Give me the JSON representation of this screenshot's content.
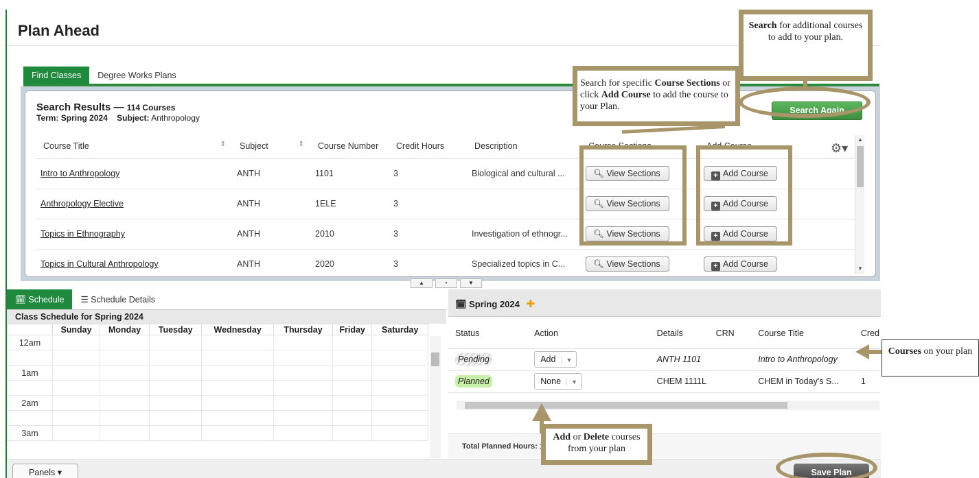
{
  "page_title": "Plan Ahead",
  "top_tabs": [
    "Find Classes",
    "Degree Works Plans"
  ],
  "results": {
    "heading": "Search Results —",
    "count": "114 Courses",
    "term_label": "Term:",
    "term": "Spring 2024",
    "subject_label": "Subject:",
    "subject": "Anthropology",
    "search_again": "Search Again",
    "columns": [
      "Course Title",
      "Subject",
      "Course Number",
      "Credit Hours",
      "Description",
      "Course Sections",
      "Add Course"
    ],
    "rows": [
      {
        "title": "Intro to Anthropology",
        "subject": "ANTH",
        "number": "1101",
        "credits": "3",
        "description": "Biological and cultural ...",
        "sections": "View Sections",
        "add": "Add Course"
      },
      {
        "title": "Anthropology Elective",
        "subject": "ANTH",
        "number": "1ELE",
        "credits": "3",
        "description": "",
        "sections": "View Sections",
        "add": "Add Course"
      },
      {
        "title": "Topics in Ethnography",
        "subject": "ANTH",
        "number": "2010",
        "credits": "3",
        "description": "Investigation of ethnogr...",
        "sections": "View Sections",
        "add": "Add Course"
      },
      {
        "title": "Topics in Cultural Anthropology",
        "subject": "ANTH",
        "number": "2020",
        "credits": "3",
        "description": "Specialized topics in C...",
        "sections": "View Sections",
        "add": "Add Course"
      }
    ]
  },
  "schedule": {
    "tabs": [
      "Schedule",
      "Schedule Details"
    ],
    "title": "Class Schedule for Spring 2024",
    "days": [
      "Sunday",
      "Monday",
      "Tuesday",
      "Wednesday",
      "Thursday",
      "Friday",
      "Saturday"
    ],
    "times": [
      "12am",
      "",
      "1am",
      "",
      "2am",
      "",
      "3am"
    ]
  },
  "plan": {
    "term": "Spring 2024",
    "columns": [
      "Status",
      "Action",
      "Details",
      "CRN",
      "Course Title",
      "Cred"
    ],
    "rows": [
      {
        "status": "Pending",
        "action": "Add",
        "details": "ANTH 1101",
        "crn": "",
        "title": "Intro to Anthropology",
        "credits": ""
      },
      {
        "status": "Planned",
        "action": "None",
        "details": "CHEM 1111L",
        "crn": "",
        "title": "CHEM in Today's S...",
        "credits": "1"
      }
    ],
    "total_label": "Total Planned Hours: 1"
  },
  "footer": {
    "panels": "Panels",
    "save_plan": "Save Plan"
  },
  "callouts": {
    "search_bold": "Search",
    "search_rest": " for additional courses to add to your plan.",
    "sections_pre": "Search for specific ",
    "sections_bold1": "Course Sections",
    "sections_mid": " or click ",
    "sections_bold2": "Add Course",
    "sections_post": " to add the course to your Plan.",
    "courses_bold": "Courses",
    "courses_rest": " on your plan",
    "add_bold": "Add",
    "add_mid": " or ",
    "delete_bold": "Delete",
    "add_rest": " courses from your plan"
  },
  "colors": {
    "accent": "#1f8a3e",
    "annotation": "#a8956a"
  }
}
